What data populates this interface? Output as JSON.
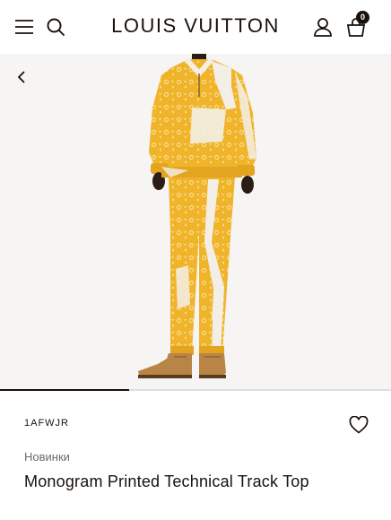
{
  "header": {
    "brand": "LOUIS VUITTON",
    "menu_icon": "hamburger-menu-icon",
    "search_icon": "search-icon",
    "account_icon": "user-icon",
    "bag_icon": "shopping-bag-icon",
    "bag_count": "0"
  },
  "gallery": {
    "back_icon": "chevron-left-icon",
    "image_subject": "Model wearing yellow monogram printed track top and matching pants with brown boots",
    "progress": 0.33
  },
  "product": {
    "sku": "1AFWJR",
    "category": "Новинки",
    "name": "Monogram Printed Technical Track Top",
    "wishlist_icon": "heart-icon"
  },
  "colors": {
    "text": "#19110b",
    "muted": "#6d6a66",
    "image_bg": "#f6f5f3",
    "garment_yellow": "#f0b42a",
    "garment_white": "#f3efe6"
  }
}
